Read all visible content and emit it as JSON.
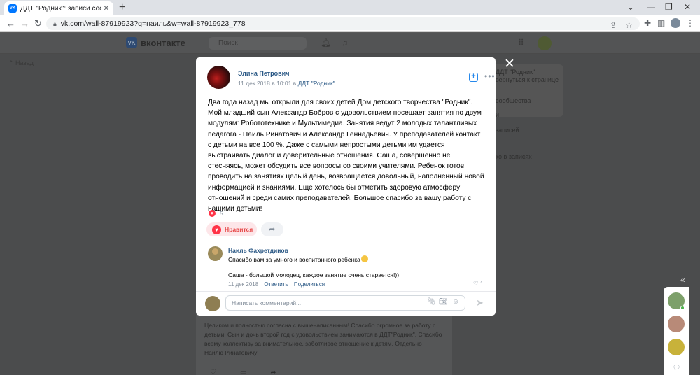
{
  "browser": {
    "tab_title": "ДДТ \"Родник\": записи сообщест",
    "favicon_text": "VK",
    "url": "vk.com/wall-87919923?q=наиль&w=wall-87919923_778"
  },
  "vk": {
    "logo": "вконтакте",
    "search_placeholder": "Поиск",
    "back_link": "Назад",
    "side_texts": [
      "ДДТ \"Родник\"",
      "вернуться к странице",
      "сообщества",
      "и",
      "записей",
      "ко в записях"
    ],
    "bg_post_text": "Целиком и полностью согласна с вышенаписанным! Спасибо огромное за работу с детьми. Сын и дочь второй год с удовольствием занимаются в ДДТ\"Родник\". Спасибо всему коллективу за внимательное, заботливое отношение к детям. Отдельно Наилю Ринатовичу!"
  },
  "post": {
    "author": "Элина Петрович",
    "date": "11 дек 2018 в 10:01 в",
    "group": "ДДТ \"Родник\"",
    "text": "Два года назад мы открыли для своих детей Дом детского творчества \"Родник\". Мой младший сын Александр Бобров с удовольствием посещает занятия по двум модулям: Робототехнике и Мультимедиа. Занятия ведут 2 молодых талантливых педагога - Наиль Ринатович и Александр Геннадьевич. У преподавателей контакт с детьми на все 100 %. Даже с самыми непростыми детьми им удается выстраивать диалог и доверительные отношения. Саша, совершенно не стесняясь, может обсудить все вопросы со своими учителями. Ребенок готов проводить на занятиях целый день, возвращается довольный, наполненный новой информацией и знаниями. Еще хотелось бы отметить здоровую атмосферу отношений и среди самих преподавателей. Большое спасибо за вашу работу с нашими детьми!",
    "likes_count": "5",
    "like_label": "Нравится"
  },
  "comment": {
    "author": "Наиль Фахретдинов",
    "line1": "Спасибо вам за умного и воспитанного ребенка",
    "line2": "Саша - большой молодец, каждое занятие очень старается!))",
    "date": "11 дек 2018",
    "reply": "Ответить",
    "share": "Поделиться",
    "likes": "1"
  },
  "comment_input": {
    "placeholder": "Написать комментарий..."
  },
  "icons": {
    "collapse": "double-chevron-left-icon",
    "chat": "chat-bubble-icon"
  }
}
